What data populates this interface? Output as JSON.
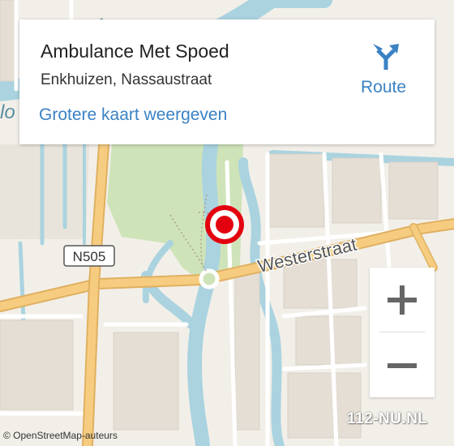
{
  "card": {
    "title": "Ambulance Met Spoed",
    "subtitle": "Enkhuizen, Nassaustraat",
    "link": "Grotere kaart weergeven",
    "route_label": "Route"
  },
  "map": {
    "street_westerstraat": "Westerstraat",
    "road_badge": "N505",
    "water_label_partial_top": "we",
    "water_label_partial_left": "lo",
    "marker": "location-pin-icon"
  },
  "zoom": {
    "in_icon": "plus-icon",
    "out_icon": "minus-icon"
  },
  "attribution": "© OpenStreetMap-auteurs",
  "watermark": "112-NU.NL",
  "colors": {
    "land": "#f2efe9",
    "water": "#aad3df",
    "park": "#cfe3b9",
    "road_major": "#f6cd80",
    "marker": "#e3000f",
    "link": "#3b82c4"
  }
}
